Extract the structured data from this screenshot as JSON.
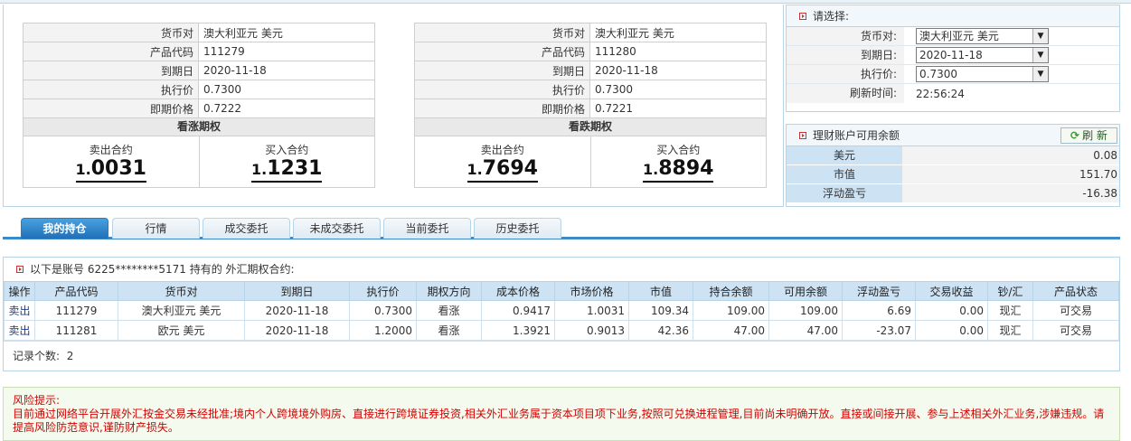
{
  "call": {
    "rows": [
      {
        "label": "货币对",
        "value": "澳大利亚元 美元"
      },
      {
        "label": "产品代码",
        "value": "111279"
      },
      {
        "label": "到期日",
        "value": "2020-11-18"
      },
      {
        "label": "执行价",
        "value": "0.7300"
      },
      {
        "label": "即期价格",
        "value": "0.7222"
      }
    ],
    "type_label": "看涨期权",
    "sell": {
      "label": "卖出合约",
      "prefix": "1.",
      "main": "0031"
    },
    "buy": {
      "label": "买入合约",
      "prefix": "1.",
      "main": "1231"
    }
  },
  "put": {
    "rows": [
      {
        "label": "货币对",
        "value": "澳大利亚元 美元"
      },
      {
        "label": "产品代码",
        "value": "111280"
      },
      {
        "label": "到期日",
        "value": "2020-11-18"
      },
      {
        "label": "执行价",
        "value": "0.7300"
      },
      {
        "label": "即期价格",
        "value": "0.7221"
      }
    ],
    "type_label": "看跌期权",
    "sell": {
      "label": "卖出合约",
      "prefix": "1.",
      "main": "7694"
    },
    "buy": {
      "label": "买入合约",
      "prefix": "1.",
      "main": "8894"
    }
  },
  "select": {
    "title": "请选择:",
    "pair_label": "货币对:",
    "pair_value": "澳大利亚元 美元",
    "expiry_label": "到期日:",
    "expiry_value": "2020-11-18",
    "strike_label": "执行价:",
    "strike_value": "0.7300",
    "refresh_label": "刷新时间:",
    "refresh_time": "22:56:24"
  },
  "balance": {
    "title": "理财账户可用余额",
    "refresh_button": "刷 新",
    "rows": [
      {
        "label": "美元",
        "value": "0.08"
      },
      {
        "label": "市值",
        "value": "151.70"
      },
      {
        "label": "浮动盈亏",
        "value": "-16.38"
      }
    ]
  },
  "tabs": [
    "我的持仓",
    "行情",
    "成交委托",
    "未成交委托",
    "当前委托",
    "历史委托"
  ],
  "holdings": {
    "heading": "以下是账号 6225********5171 持有的 外汇期权合约:",
    "columns": [
      "操作",
      "产品代码",
      "货币对",
      "到期日",
      "执行价",
      "期权方向",
      "成本价格",
      "市场价格",
      "市值",
      "持合余额",
      "可用余额",
      "浮动盈亏",
      "交易收益",
      "钞/汇",
      "产品状态"
    ],
    "rows": [
      [
        "卖出",
        "111279",
        "澳大利亚元 美元",
        "2020-11-18",
        "0.7300",
        "看涨",
        "0.9417",
        "1.0031",
        "109.34",
        "109.00",
        "109.00",
        "6.69",
        "0.00",
        "现汇",
        "可交易"
      ],
      [
        "卖出",
        "111281",
        "欧元 美元",
        "2020-11-18",
        "1.2000",
        "看涨",
        "1.3921",
        "0.9013",
        "42.36",
        "47.00",
        "47.00",
        "-23.07",
        "0.00",
        "现汇",
        "可交易"
      ]
    ],
    "record_count_label": "记录个数:",
    "record_count": "2"
  },
  "risk": {
    "title": "风险提示:",
    "text": "目前通过网络平台开展外汇按金交易未经批准;境内个人跨境境外购房、直接进行跨境证券投资,相关外汇业务属于资本项目项下业务,按照可兑换进程管理,目前尚未明确开放。直接或间接开展、参与上述相关外汇业务,涉嫌违规。请提高风险防范意识,谨防财产损失。"
  }
}
